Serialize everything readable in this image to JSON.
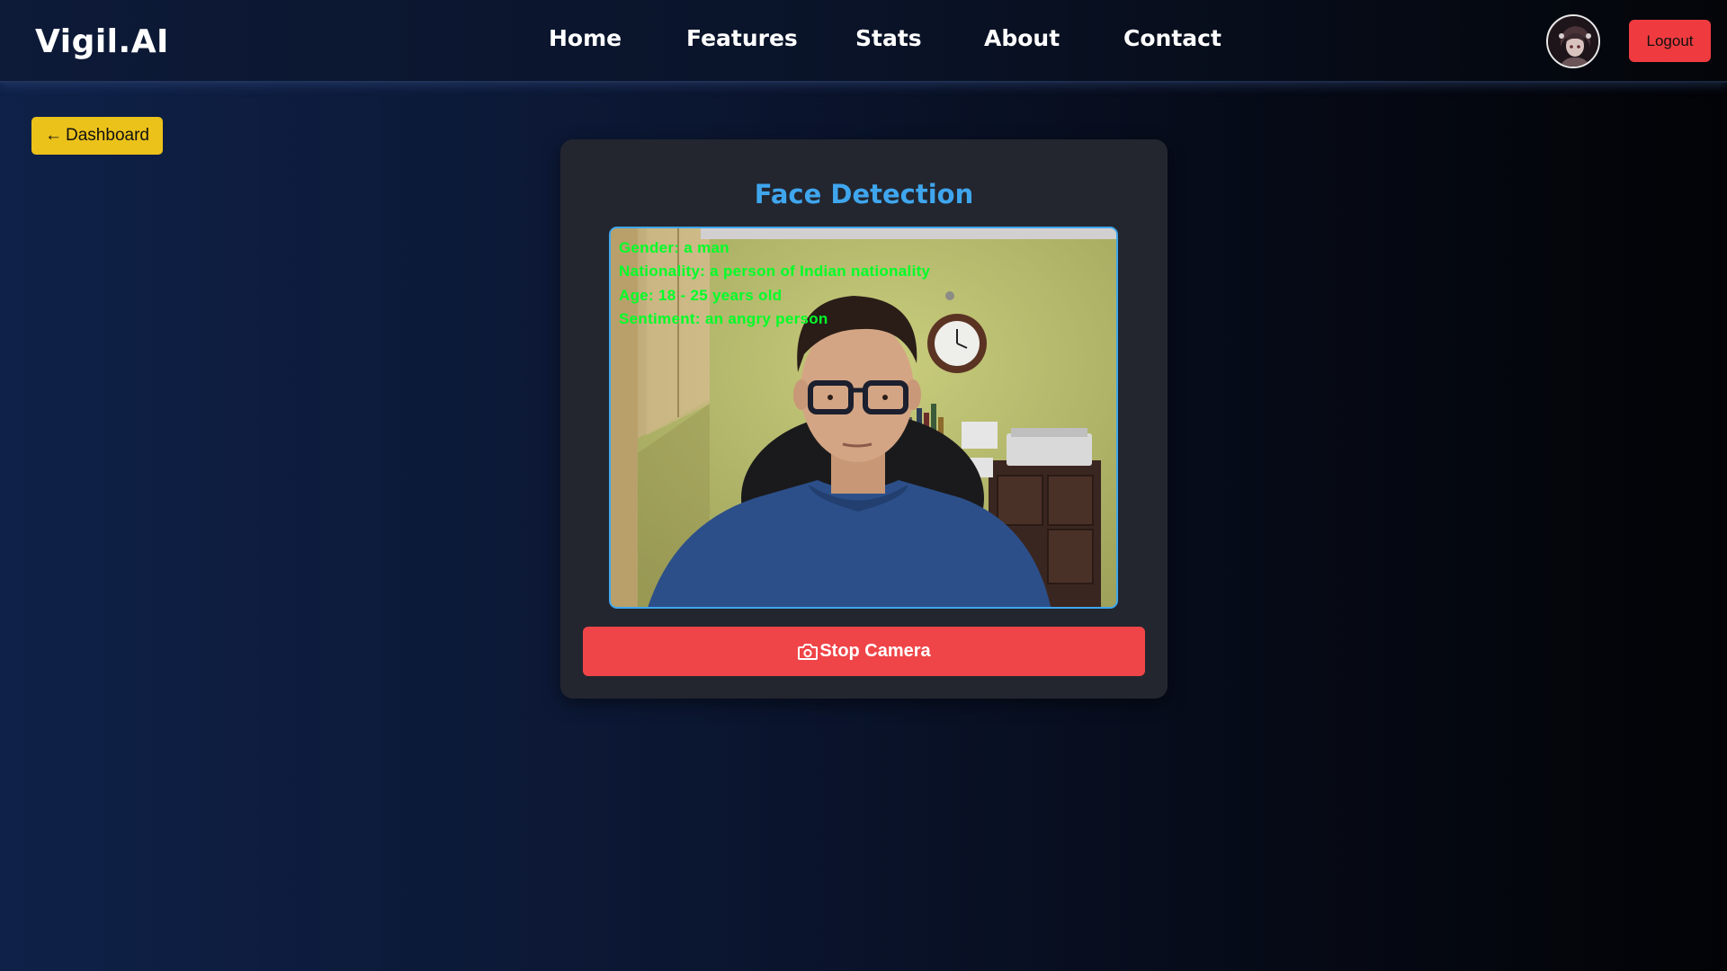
{
  "app": {
    "title": "Vigil.AI"
  },
  "nav": {
    "items": [
      {
        "label": "Home"
      },
      {
        "label": "Features"
      },
      {
        "label": "Stats"
      },
      {
        "label": "About"
      },
      {
        "label": "Contact"
      }
    ],
    "logout_label": "Logout"
  },
  "back_button": {
    "arrow": "←",
    "label": "Dashboard"
  },
  "detector": {
    "title": "Face Detection",
    "overlay": {
      "gender": "Gender: a man",
      "nationality": "Nationality: a person of Indian nationality",
      "age": "Age: 18 - 25 years old",
      "sentiment": "Sentiment: an angry person"
    },
    "stop_label": "Stop Camera"
  },
  "colors": {
    "accent": "#3fa6ee",
    "danger": "#ef4548",
    "warning": "#ebc21a",
    "overlay_text": "#00ff28",
    "card_bg": "#23262f"
  },
  "icons": {
    "stop_camera": "camera-icon",
    "back": "arrow-left-icon"
  }
}
